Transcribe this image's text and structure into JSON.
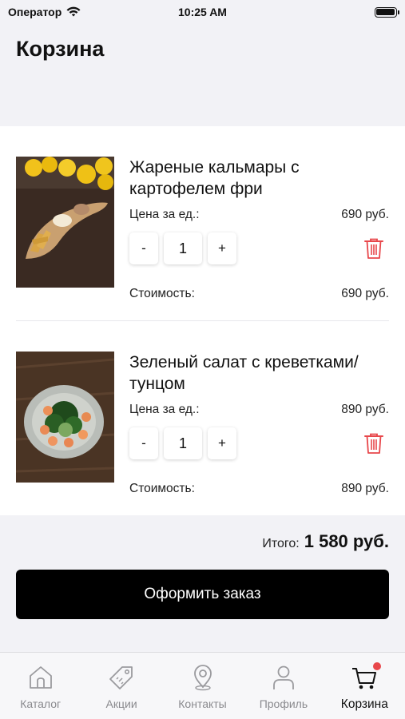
{
  "status_bar": {
    "carrier": "Оператор",
    "time": "10:25 AM"
  },
  "header": {
    "title": "Корзина"
  },
  "cart": {
    "items": [
      {
        "name": "Жареные кальмары с картофелем фри",
        "unit_price_label": "Цена за ед.:",
        "unit_price": "690 руб.",
        "quantity": "1",
        "cost_label": "Стоимость:",
        "cost": "690 руб.",
        "image": "fried-calamari-with-fries-photo"
      },
      {
        "name": "Зеленый салат с креветками/тунцом",
        "unit_price_label": "Цена за ед.:",
        "unit_price": "890 руб.",
        "quantity": "1",
        "cost_label": "Стоимость:",
        "cost": "890 руб.",
        "image": "green-salad-with-shrimp-photo"
      }
    ],
    "minus_label": "-",
    "plus_label": "+"
  },
  "summary": {
    "total_label": "Итого:",
    "total_value": "1 580 руб.",
    "checkout_label": "Оформить заказ"
  },
  "tab_bar": {
    "tabs": [
      {
        "label": "Каталог",
        "icon": "home-icon",
        "active": false
      },
      {
        "label": "Акции",
        "icon": "tag-icon",
        "active": false
      },
      {
        "label": "Контакты",
        "icon": "location-pin-icon",
        "active": false
      },
      {
        "label": "Профиль",
        "icon": "person-icon",
        "active": false
      },
      {
        "label": "Корзина",
        "icon": "cart-icon",
        "active": true
      }
    ]
  },
  "colors": {
    "accent": "#000000",
    "delete": "#e8474b",
    "badge": "#e8474b",
    "background": "#f2f2f6"
  }
}
